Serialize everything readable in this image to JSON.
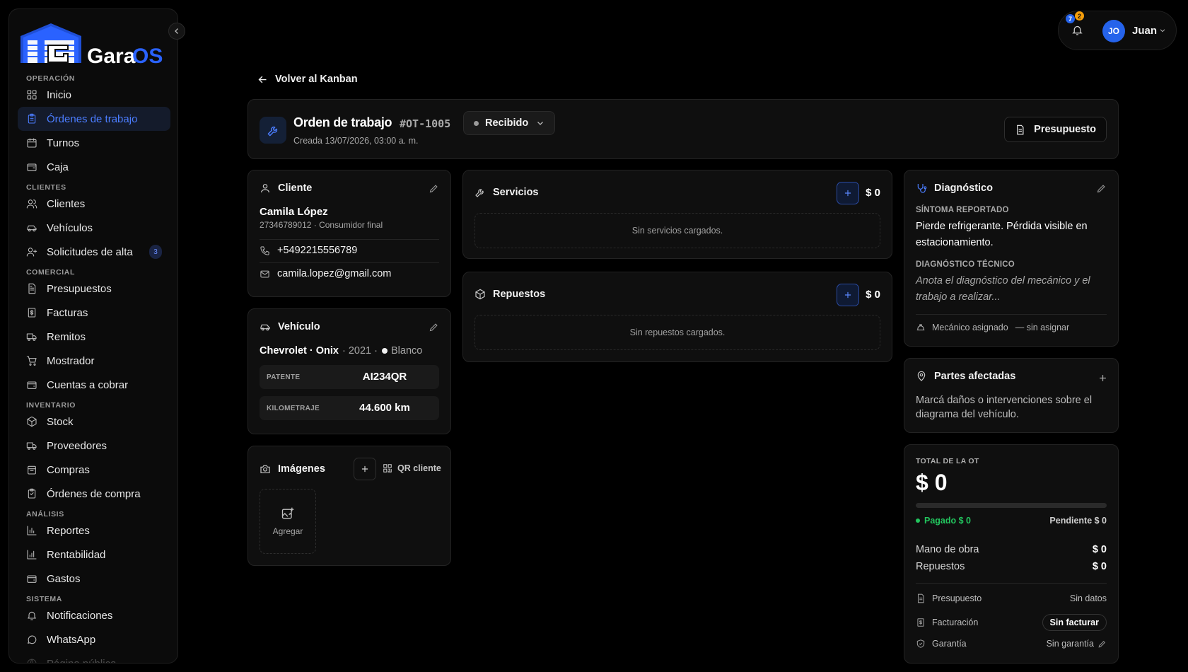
{
  "app": {
    "name": "GaraOS"
  },
  "sidebar": {
    "sections": [
      {
        "title": "OPERACIÓN",
        "items": [
          {
            "label": "Inicio",
            "icon": "grid-icon"
          },
          {
            "label": "Órdenes de trabajo",
            "icon": "clipboard-icon",
            "active": true
          },
          {
            "label": "Turnos",
            "icon": "calendar-icon"
          },
          {
            "label": "Caja",
            "icon": "cash-register-icon"
          }
        ]
      },
      {
        "title": "CLIENTES",
        "items": [
          {
            "label": "Clientes",
            "icon": "users-icon"
          },
          {
            "label": "Vehículos",
            "icon": "car-icon"
          },
          {
            "label": "Solicitudes de alta",
            "icon": "user-plus-icon",
            "badge": "3"
          }
        ]
      },
      {
        "title": "COMERCIAL",
        "items": [
          {
            "label": "Presupuestos",
            "icon": "document-icon"
          },
          {
            "label": "Facturas",
            "icon": "invoice-icon"
          },
          {
            "label": "Remitos",
            "icon": "truck-icon"
          },
          {
            "label": "Mostrador",
            "icon": "cart-icon"
          },
          {
            "label": "Cuentas a cobrar",
            "icon": "wallet-icon"
          }
        ]
      },
      {
        "title": "INVENTARIO",
        "items": [
          {
            "label": "Stock",
            "icon": "box-icon"
          },
          {
            "label": "Proveedores",
            "icon": "truck-icon"
          },
          {
            "label": "Compras",
            "icon": "bag-icon"
          },
          {
            "label": "Órdenes de compra",
            "icon": "clipboard-icon"
          }
        ]
      },
      {
        "title": "ANÁLISIS",
        "items": [
          {
            "label": "Reportes",
            "icon": "bar-chart-icon"
          },
          {
            "label": "Rentabilidad",
            "icon": "bar-chart-icon"
          },
          {
            "label": "Gastos",
            "icon": "wallet-icon"
          }
        ]
      },
      {
        "title": "SISTEMA",
        "items": [
          {
            "label": "Notificaciones",
            "icon": "bell-icon"
          },
          {
            "label": "WhatsApp",
            "icon": "chat-icon"
          },
          {
            "label": "Página pública",
            "icon": "globe-icon"
          }
        ]
      }
    ]
  },
  "topbar": {
    "notif_blue": "7",
    "notif_orange": "2",
    "avatar_initials": "JO",
    "user_name": "Juan"
  },
  "back_link": "Volver al Kanban",
  "order": {
    "title": "Orden de trabajo",
    "number": "#OT-1005",
    "status": "Recibido",
    "created": "Creada 13/07/2026, 03:00 a. m.",
    "budget_button": "Presupuesto"
  },
  "client": {
    "title": "Cliente",
    "name": "Camila López",
    "sub": "27346789012 · Consumidor final",
    "phone": "+5492215556789",
    "email": "camila.lopez@gmail.com"
  },
  "vehicle": {
    "title": "Vehículo",
    "make_model": "Chevrolet · Onix",
    "year": "· 2021 ·",
    "color": "Blanco",
    "plate_label": "PATENTE",
    "plate": "AI234QR",
    "km_label": "KILOMETRAJE",
    "km": "44.600 km"
  },
  "images": {
    "title": "Imágenes",
    "qr_label": "QR cliente",
    "add_label": "Agregar"
  },
  "services": {
    "title": "Servicios",
    "amount": "$ 0",
    "empty": "Sin servicios cargados."
  },
  "parts": {
    "title": "Repuestos",
    "amount": "$ 0",
    "empty": "Sin repuestos cargados."
  },
  "diagnosis": {
    "title": "Diagnóstico",
    "symptom_label": "SÍNTOMA REPORTADO",
    "symptom": "Pierde refrigerante. Pérdida visible en estacionamiento.",
    "tech_label": "DIAGNÓSTICO TÉCNICO",
    "tech_placeholder": "Anota el diagnóstico del mecánico y el trabajo a realizar...",
    "mechanic_label": "Mecánico asignado",
    "mechanic_value": "— sin asignar"
  },
  "affected": {
    "title": "Partes afectadas",
    "text": "Marcá daños o intervenciones sobre el diagrama del vehículo."
  },
  "total": {
    "label": "TOTAL DE LA OT",
    "value": "$ 0",
    "paid_fraction": 0,
    "paid": "Pagado $ 0",
    "pending": "Pendiente $ 0",
    "labor_label": "Mano de obra",
    "labor": "$ 0",
    "parts_label": "Repuestos",
    "parts": "$ 0",
    "budget_label": "Presupuesto",
    "budget_value": "Sin datos",
    "billing_label": "Facturación",
    "billing_value": "Sin facturar",
    "warranty_label": "Garantía",
    "warranty_value": "Sin garantía"
  },
  "colors": {
    "accent": "#4b7dff",
    "paid": "#22c55e",
    "notif_orange": "#f59e0b"
  }
}
